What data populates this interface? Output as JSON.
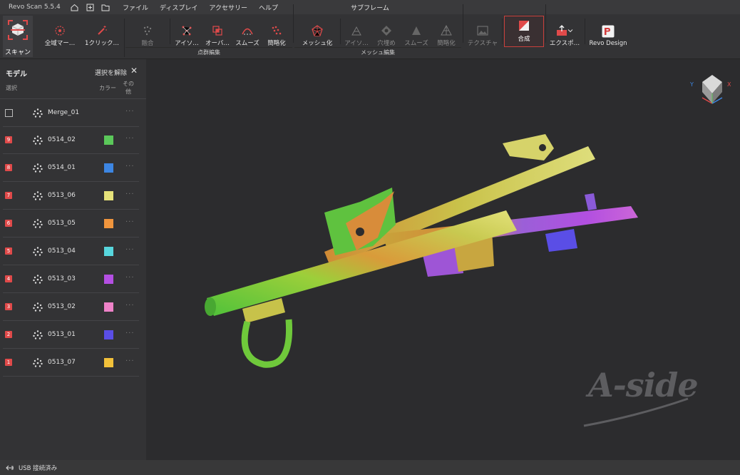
{
  "titlebar": {
    "app_name": "Revo Scan 5.5.4",
    "menu": [
      "ファイル",
      "ディスプレイ",
      "アクセサリー",
      "ヘルプ"
    ],
    "document_title": "サブフレーム"
  },
  "toolbar": {
    "scan": "スキャン",
    "global_marker": "全域マー…",
    "one_click": "1クリック…",
    "fusion": "融合",
    "isolate": "アイソ…",
    "overlap": "オーバ…",
    "smooth": "スムーズ",
    "simplify": "簡略化",
    "point_cloud_group": "点群編集",
    "meshing": "メッシュ化",
    "mesh_isolate": "アイソ…",
    "fill_holes": "穴埋め",
    "mesh_smooth": "スムーズ",
    "mesh_simplify": "簡略化",
    "mesh_group": "メッシュ編集",
    "texture": "テクスチャ",
    "composite": "合成",
    "export": "エクスポ…",
    "revo_design": "Revo Design"
  },
  "sidebar": {
    "title": "モデル",
    "clear_selection": "選択を解除",
    "col_select": "選択",
    "col_color": "カラー",
    "col_other_1": "その",
    "col_other_2": "他",
    "items": [
      {
        "badge": "",
        "name": "Merge_01",
        "color": ""
      },
      {
        "badge": "9",
        "name": "0514_02",
        "color": "#5bc85a"
      },
      {
        "badge": "8",
        "name": "0514_01",
        "color": "#3d86e3"
      },
      {
        "badge": "7",
        "name": "0513_06",
        "color": "#e6e27a"
      },
      {
        "badge": "6",
        "name": "0513_05",
        "color": "#f0953d"
      },
      {
        "badge": "5",
        "name": "0513_04",
        "color": "#57d6dd"
      },
      {
        "badge": "4",
        "name": "0513_03",
        "color": "#b44fe3"
      },
      {
        "badge": "3",
        "name": "0513_02",
        "color": "#ee82c8"
      },
      {
        "badge": "2",
        "name": "0513_01",
        "color": "#5a4ee6"
      },
      {
        "badge": "1",
        "name": "0513_07",
        "color": "#f2c13a"
      }
    ]
  },
  "viewport": {
    "watermark": "A-side",
    "axis": {
      "x": "X",
      "y": "Y"
    }
  },
  "statusbar": {
    "connection": "USB 接続済み"
  }
}
